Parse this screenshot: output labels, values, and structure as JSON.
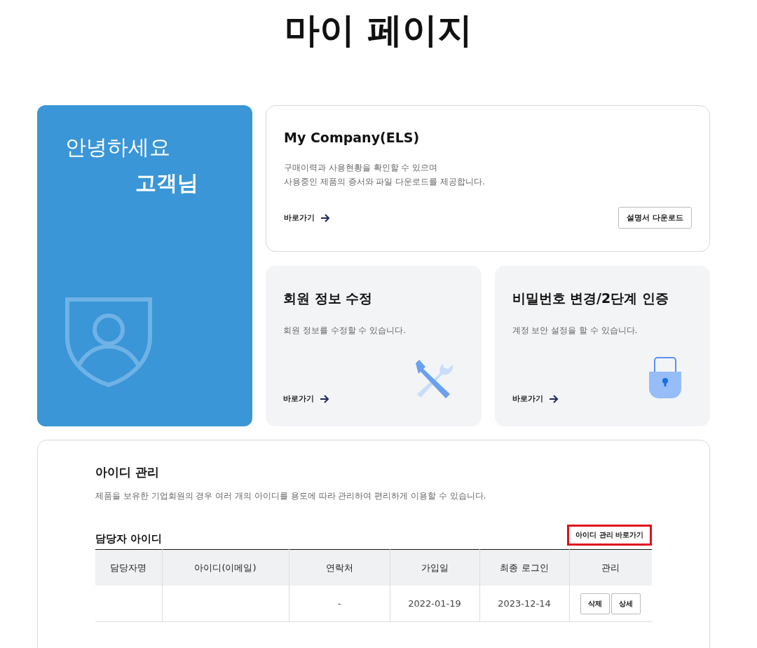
{
  "page_title": "마이 페이지",
  "greeting": {
    "line1": "안녕하세요",
    "line2": "고객님"
  },
  "company_card": {
    "title": "My Company(ELS)",
    "description_lines": [
      "구매이력과 사용현황을 확인할 수 있으며",
      "사용중인 제품의 증서와 파일 다운로드를 제공합니다."
    ],
    "link": "바로가기",
    "button": "설명서 다운로드"
  },
  "small_cards": [
    {
      "kind": "tools",
      "title": "회원 정보 수정",
      "description": "회원 정보를 수정할 수 있습니다.",
      "link": "바로가기"
    },
    {
      "kind": "lock",
      "title": "비밀번호 변경/2단계 인증",
      "description": "계정 보안 설정을 할 수 있습니다.",
      "link": "바로가기"
    }
  ],
  "id_management": {
    "title": "아이디 관리",
    "description": "제품을 보유한 기업회원의 경우 여러 개의 아이디를 용도에 따라 관리하여 편리하게 이용할 수 있습니다.",
    "subtitle": "담당자 아이디",
    "manage_button": {
      "label": "아이디 관리 바로가기",
      "highlighted": true
    },
    "table": {
      "columns": [
        "담당자명",
        "아이디(이메일)",
        "연락처",
        "가입일",
        "최종 로그인",
        "관리"
      ],
      "rows": [
        {
          "contact": "-",
          "joined": "2022-01-19",
          "last_login": "2023-12-14",
          "actions": [
            "삭제",
            "상세"
          ]
        }
      ]
    }
  }
}
